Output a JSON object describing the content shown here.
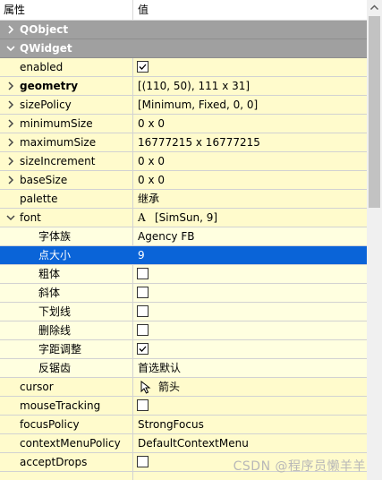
{
  "header": {
    "col_property": "属性",
    "col_value": "值"
  },
  "groups": {
    "qobject": "QObject",
    "qwidget": "QWidget"
  },
  "rows": {
    "enabled": {
      "name": "enabled",
      "checked": true
    },
    "geometry": {
      "name": "geometry",
      "value": "[(110, 50), 111 x 31]"
    },
    "sizePolicy": {
      "name": "sizePolicy",
      "value": "[Minimum, Fixed, 0, 0]"
    },
    "minimumSize": {
      "name": "minimumSize",
      "value": "0 x 0"
    },
    "maximumSize": {
      "name": "maximumSize",
      "value": "16777215 x 16777215"
    },
    "sizeIncrement": {
      "name": "sizeIncrement",
      "value": "0 x 0"
    },
    "baseSize": {
      "name": "baseSize",
      "value": "0 x 0"
    },
    "palette": {
      "name": "palette",
      "value": "继承"
    },
    "font": {
      "name": "font",
      "value": "[SimSun, 9]"
    },
    "font_family": {
      "name": "字体族",
      "value": "Agency FB"
    },
    "font_pointsize": {
      "name": "点大小",
      "value": "9"
    },
    "font_bold": {
      "name": "粗体",
      "checked": false
    },
    "font_italic": {
      "name": "斜体",
      "checked": false
    },
    "font_underline": {
      "name": "下划线",
      "checked": false
    },
    "font_strikeout": {
      "name": "删除线",
      "checked": false
    },
    "font_kerning": {
      "name": "字距调整",
      "checked": true
    },
    "font_antialias": {
      "name": "反锯齿",
      "value": "首选默认"
    },
    "cursor": {
      "name": "cursor",
      "value": "箭头"
    },
    "mouseTracking": {
      "name": "mouseTracking",
      "checked": false
    },
    "focusPolicy": {
      "name": "focusPolicy",
      "value": "StrongFocus"
    },
    "contextMenuPolicy": {
      "name": "contextMenuPolicy",
      "value": "DefaultContextMenu"
    },
    "acceptDrops": {
      "name": "acceptDrops",
      "checked": false
    }
  },
  "icons": {
    "font_glyph": "A",
    "cursor": "arrow-cursor-icon"
  },
  "watermark": "CSDN @程序员懒羊羊",
  "colors": {
    "group_bg": "#a0a0a0",
    "row_yellow": "#fffbcc",
    "selected": "#0a64d8"
  }
}
